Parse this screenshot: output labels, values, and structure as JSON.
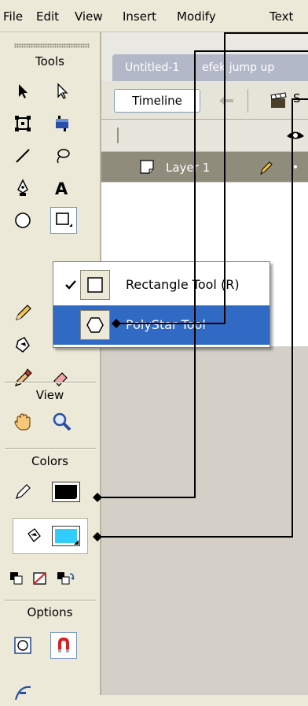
{
  "menubar": {
    "items": [
      "File",
      "Edit",
      "View",
      "Insert",
      "Modify",
      "Text"
    ]
  },
  "toolbox": {
    "tools_title": "Tools",
    "view_title": "View",
    "colors_title": "Colors",
    "options_title": "Options",
    "stroke_color": "#000000",
    "fill_color": "#33ccff"
  },
  "documents": {
    "tabs": [
      "Untitled-1",
      "efek jump up"
    ]
  },
  "timeline": {
    "button_label": "Timeline",
    "scene_label": "S",
    "layer_name": "Layer 1"
  },
  "shape_menu": {
    "items": [
      {
        "label": "Rectangle Tool (R)",
        "checked": true
      },
      {
        "label": "PolyStar Tool",
        "checked": false,
        "highlighted": true
      }
    ]
  },
  "colors": {
    "highlight": "#316ac5",
    "fill_swatch": "#33ccff",
    "stroke_swatch": "#000000"
  }
}
